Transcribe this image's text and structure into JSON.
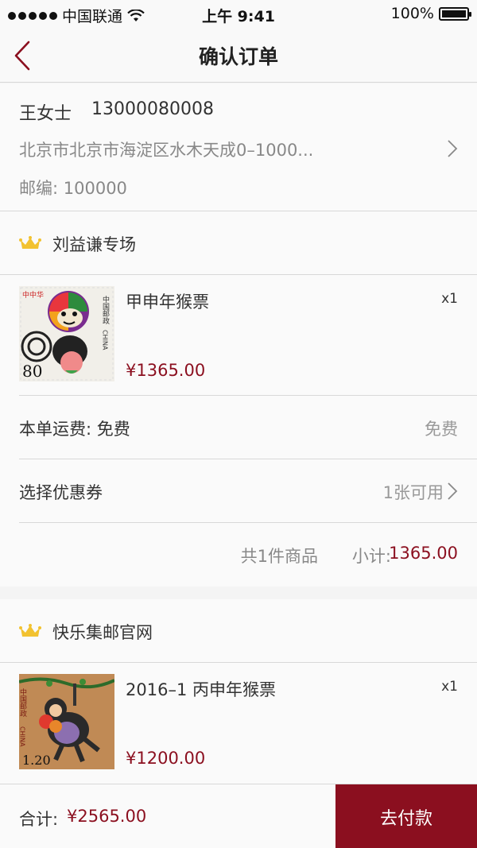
{
  "status_bar": {
    "carrier": "中国联通",
    "time": "上午 9:41",
    "battery": "100%"
  },
  "header": {
    "title": "确认订单",
    "back_icon": "chevron-left-icon"
  },
  "address": {
    "name": "王女士",
    "phone": "13000080008",
    "line": "北京市北京市海淀区水木天成0–1000...",
    "zip": "邮编: 100000"
  },
  "stores": [
    {
      "name": "刘益谦专场",
      "icon": "crown-icon",
      "items": [
        {
          "title": "甲申年猴票",
          "qty": "x1",
          "price": "¥1365.00",
          "stamp_value": "80",
          "stamp_brand": "中国邮政",
          "stamp_brand_en": "CHINA"
        }
      ],
      "shipping_label": "本单运费: 免费",
      "shipping_value": "免费",
      "coupon_label": "选择优惠券",
      "coupon_value": "1张可用",
      "summary_count": "共1件商品",
      "summary_label": "小计:",
      "summary_value": "1365.00"
    },
    {
      "name": "快乐集邮官网",
      "icon": "crown-icon",
      "items": [
        {
          "title": "2016–1 丙申年猴票",
          "qty": "x1",
          "price": "¥1200.00",
          "stamp_value": "1.20",
          "stamp_brand": "中国邮政",
          "stamp_brand_en": "CHINA"
        }
      ]
    }
  ],
  "footer": {
    "total_label": "合计:",
    "total_value": "¥2565.00",
    "pay_button": "去付款"
  },
  "colors": {
    "accent": "#8b0f1f",
    "crown": "#f2c230",
    "background": "#f4f4f4"
  }
}
